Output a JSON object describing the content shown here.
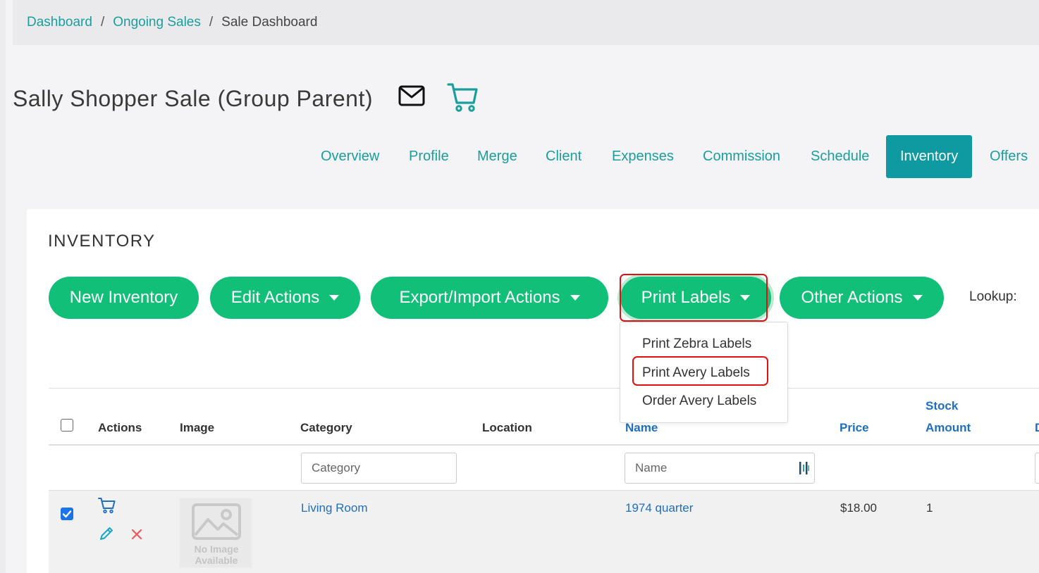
{
  "breadcrumb": {
    "items": [
      {
        "label": "Dashboard"
      },
      {
        "label": "Ongoing Sales"
      },
      {
        "label": "Sale Dashboard"
      }
    ],
    "separator": "/"
  },
  "header": {
    "title": "Sally Shopper Sale (Group Parent)",
    "icons": [
      "mail-icon",
      "cart-icon"
    ]
  },
  "tabs": [
    {
      "label": "Overview"
    },
    {
      "label": "Profile"
    },
    {
      "label": "Merge"
    },
    {
      "label": "Client"
    },
    {
      "label": "Expenses"
    },
    {
      "label": "Commission"
    },
    {
      "label": "Schedule"
    },
    {
      "label": "Inventory",
      "active": true
    },
    {
      "label": "Offers"
    }
  ],
  "inventory": {
    "title": "INVENTORY",
    "buttons": {
      "new_inventory": "New Inventory",
      "edit_actions": "Edit Actions",
      "export_import": "Export/Import Actions",
      "print_labels": "Print Labels",
      "other_actions": "Other Actions"
    },
    "lookup_label": "Lookup:",
    "print_labels_menu": [
      {
        "label": "Print Zebra Labels"
      },
      {
        "label": "Print Avery Labels"
      },
      {
        "label": "Order Avery Labels"
      }
    ]
  },
  "table": {
    "headers": {
      "actions": "Actions",
      "image": "Image",
      "category": "Category",
      "location": "Location",
      "name": "Name",
      "price": "Price",
      "stock_line1": "Stock",
      "stock_line2": "Amount",
      "next_partial": "D"
    },
    "filters": {
      "category_placeholder": "Category",
      "name_placeholder": "Name"
    },
    "rows": [
      {
        "checked": true,
        "category": "Living Room",
        "location": "",
        "name": "1974 quarter",
        "price": "$18.00",
        "stock": "1",
        "image_line1": "No Image",
        "image_line2": "Available"
      }
    ]
  },
  "colors": {
    "teal": "#1a9e9e",
    "active_tab": "#0e9aa0",
    "green_button": "#12bf78",
    "link_blue": "#1f6fc0",
    "highlight_red": "#e01010"
  }
}
